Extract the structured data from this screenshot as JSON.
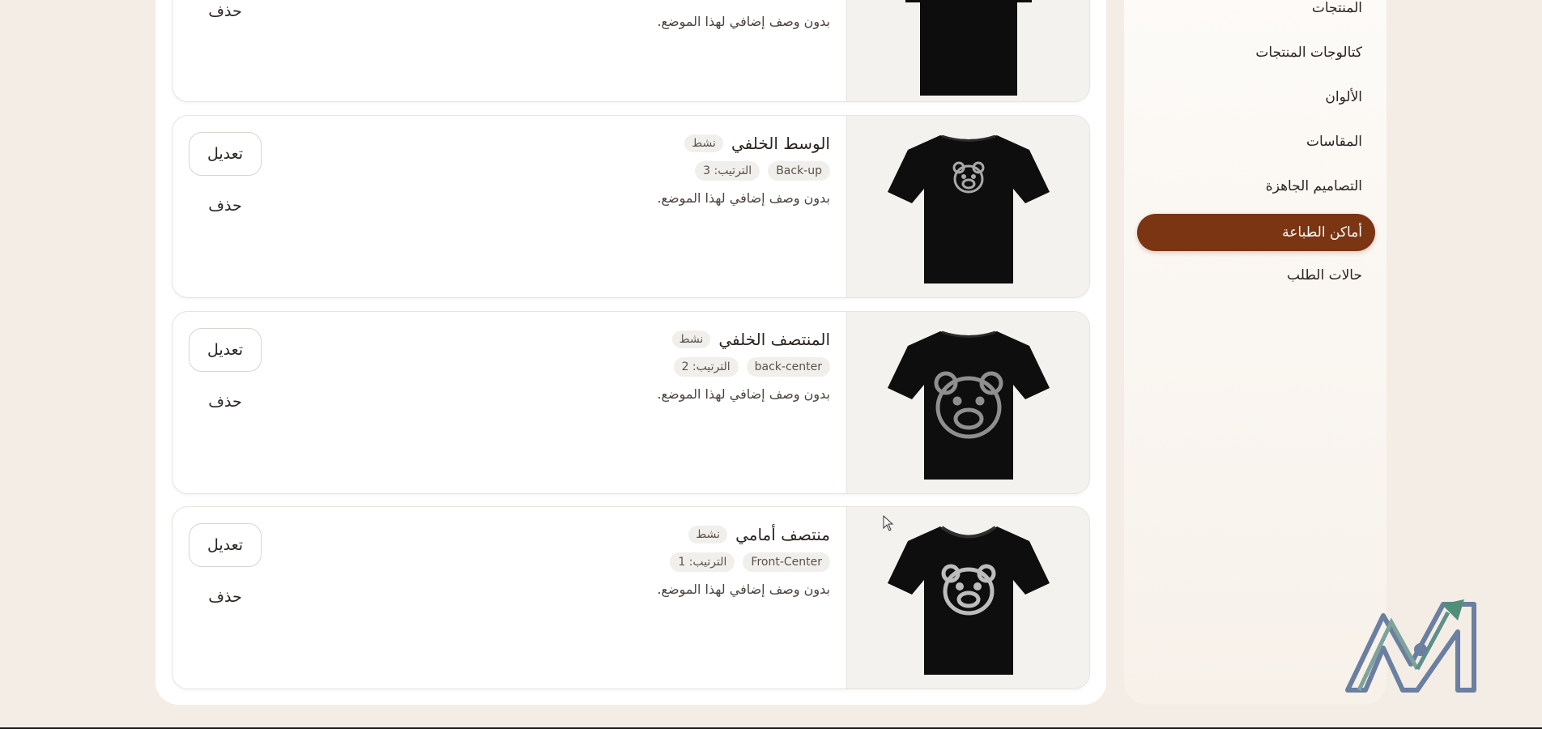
{
  "sidebar": {
    "items": [
      {
        "label": "المنتجات",
        "active": false
      },
      {
        "label": "كتالوجات المنتجات",
        "active": false
      },
      {
        "label": "الألوان",
        "active": false
      },
      {
        "label": "المقاسات",
        "active": false
      },
      {
        "label": "التصاميم الجاهزة",
        "active": false
      },
      {
        "label": "أماكن الطباعة",
        "active": true
      },
      {
        "label": "حالات الطلب",
        "active": false
      }
    ]
  },
  "cards": [
    {
      "description": "بدون وصف إضافي لهذا الموضع.",
      "delete_label": "حذف"
    },
    {
      "title": "الوسط الخلفي",
      "status": "نشط",
      "slug": "Back-up",
      "order": "الترتيب: 3",
      "description": "بدون وصف إضافي لهذا الموضع.",
      "edit_label": "تعديل",
      "delete_label": "حذف",
      "image": "tshirt-back-small-bear"
    },
    {
      "title": "المنتصف الخلفي",
      "status": "نشط",
      "slug": "back-center",
      "order": "الترتيب: 2",
      "description": "بدون وصف إضافي لهذا الموضع.",
      "edit_label": "تعديل",
      "delete_label": "حذف",
      "image": "tshirt-back-large-bear"
    },
    {
      "title": "منتصف أمامي",
      "status": "نشط",
      "slug": "Front-Center",
      "order": "الترتيب: 1",
      "description": "بدون وصف إضافي لهذا الموضع.",
      "edit_label": "تعديل",
      "delete_label": "حذف",
      "image": "tshirt-front-bear"
    }
  ],
  "colors": {
    "accent": "#7b3513",
    "page_bg": "#f3ede6"
  }
}
